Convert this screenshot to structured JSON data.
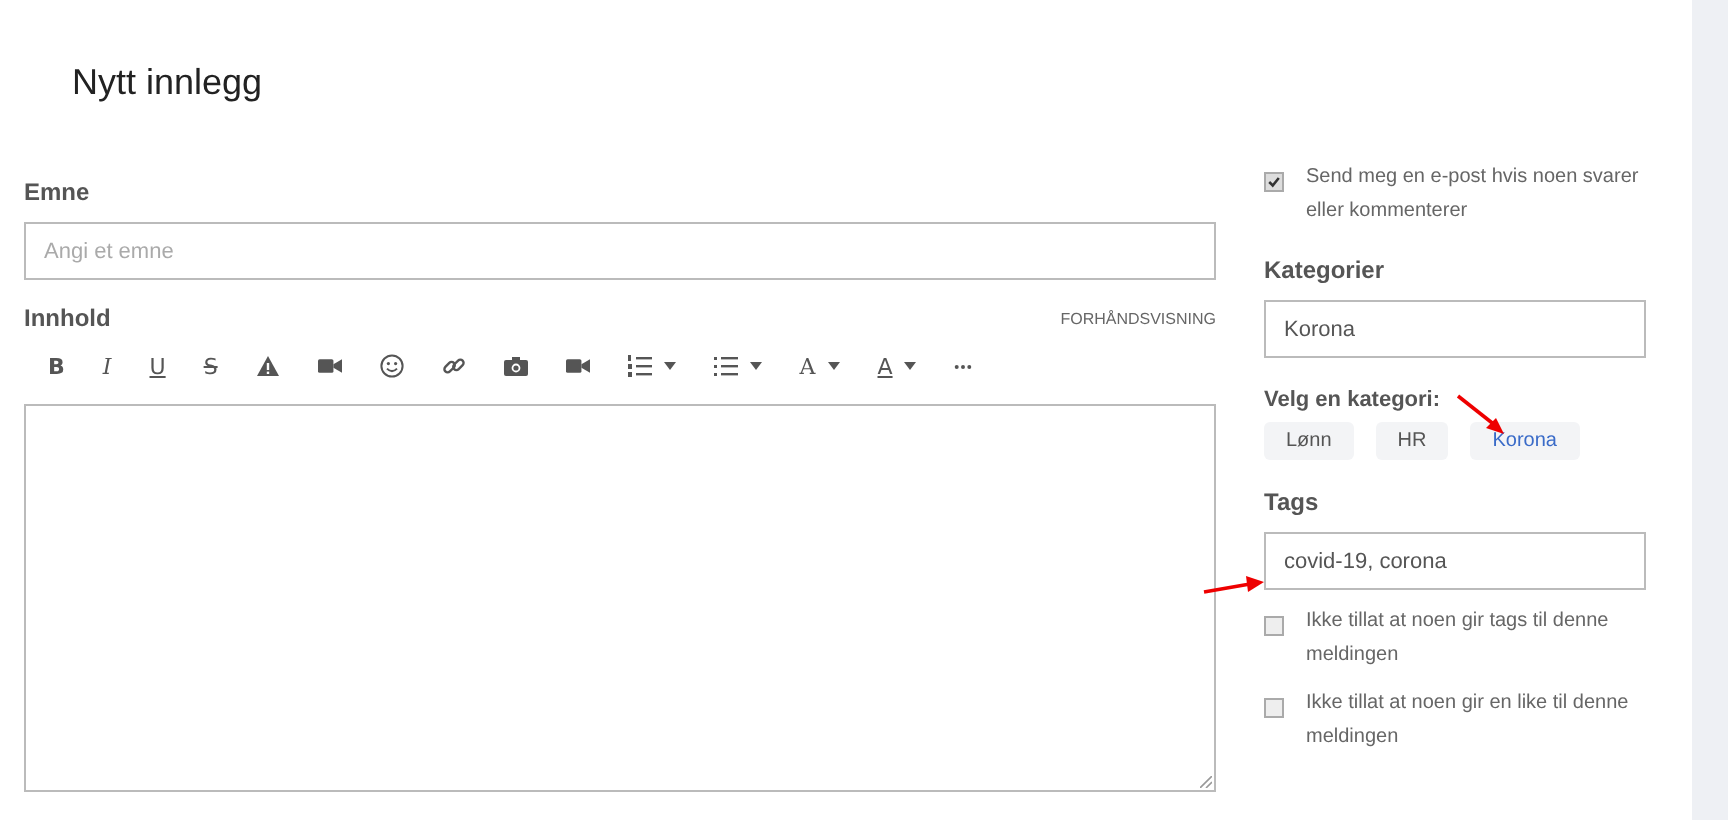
{
  "title": "Nytt innlegg",
  "subject": {
    "label": "Emne",
    "placeholder": "Angi et emne"
  },
  "content": {
    "label": "Innhold",
    "preview_link": "FORHÅNDSVISNING",
    "toolbar": [
      {
        "kind": "bold",
        "label": "B"
      },
      {
        "kind": "italic",
        "label": "I"
      },
      {
        "kind": "underline",
        "label": "U"
      },
      {
        "kind": "strike",
        "label": "S"
      },
      {
        "kind": "warning"
      },
      {
        "kind": "video"
      },
      {
        "kind": "emoji"
      },
      {
        "kind": "link"
      },
      {
        "kind": "camera"
      },
      {
        "kind": "video"
      },
      {
        "kind": "ol"
      },
      {
        "kind": "ul"
      },
      {
        "kind": "font",
        "label": "A"
      },
      {
        "kind": "color",
        "label": "A"
      },
      {
        "kind": "more"
      }
    ]
  },
  "notify": {
    "label": "Send meg en e-post hvis noen svarer eller kommenterer",
    "checked": true
  },
  "categories": {
    "label": "Kategorier",
    "value": "Korona",
    "choose_label": "Velg en kategori:",
    "options": [
      {
        "label": "Lønn",
        "selected": false
      },
      {
        "label": "HR",
        "selected": false
      },
      {
        "label": "Korona",
        "selected": true
      }
    ]
  },
  "tags": {
    "label": "Tags",
    "value": "covid-19, corona"
  },
  "options": [
    {
      "label": "Ikke tillat at noen gir tags til denne meldingen",
      "checked": false
    },
    {
      "label": "Ikke tillat at noen gir en like til denne meldingen",
      "checked": false
    }
  ]
}
